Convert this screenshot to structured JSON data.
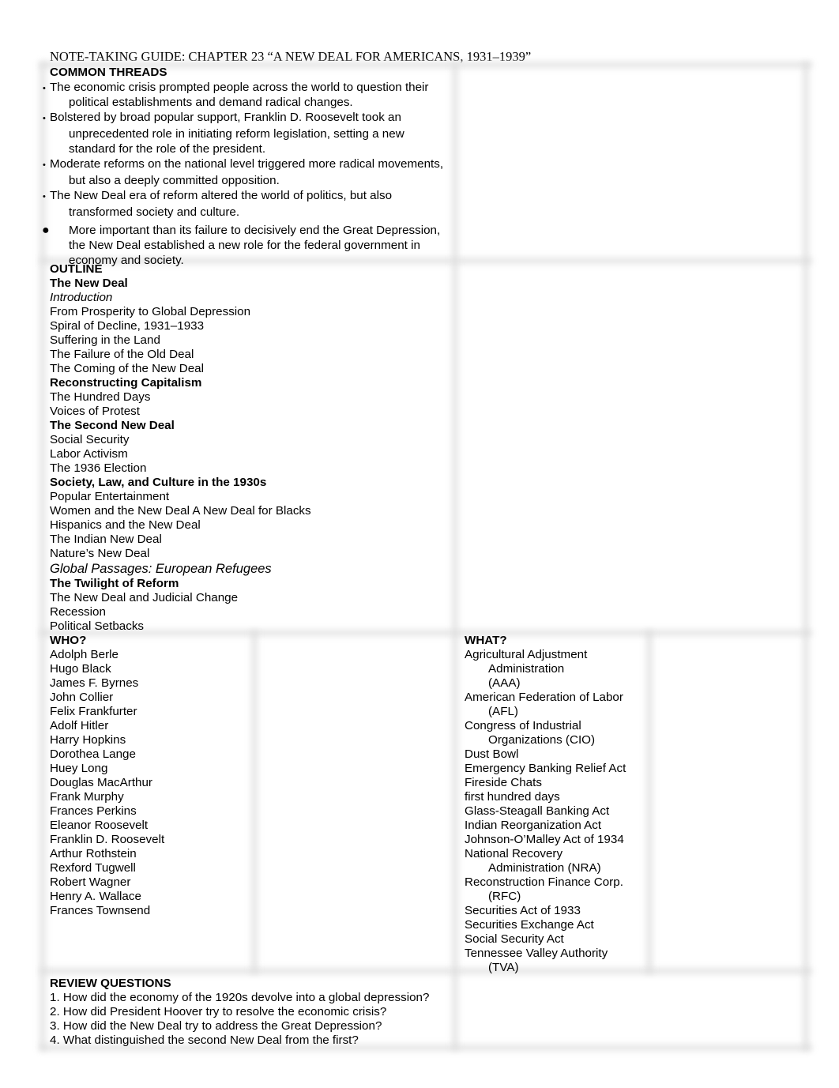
{
  "document": {
    "title": "NOTE-TAKING GUIDE: CHAPTER 23 “A NEW DEAL FOR AMERICANS, 1931–1939”"
  },
  "common_threads": {
    "heading": "COMMON THREADS",
    "items": [
      {
        "bullet": "•",
        "text": "The economic crisis prompted people across the world to question their political establishments and demand radical changes."
      },
      {
        "bullet": "•",
        "text": "Bolstered by broad popular support, Franklin D. Roosevelt took an unprecedented role in initiating reform legislation, setting a new standard for the role of the president."
      },
      {
        "bullet": "•",
        "text": "Moderate reforms on the national level triggered more radical movements, but also a deeply committed opposition."
      },
      {
        "bullet": "•",
        "text": "The New Deal era of reform altered the world of politics, but also transformed society and culture."
      },
      {
        "bullet": "●",
        "text": "More important than its failure to decisively end the Great Depression, the New Deal established a new role for the federal government in economy and society."
      }
    ]
  },
  "outline": {
    "heading": "OUTLINE",
    "lines": [
      {
        "text": "The New Deal",
        "style": "bold"
      },
      {
        "text": "Introduction",
        "style": "italic"
      },
      {
        "text": "From Prosperity to Global Depression",
        "style": "normal"
      },
      {
        "text": "Spiral of Decline, 1931–1933",
        "style": "normal"
      },
      {
        "text": "Suffering in the Land",
        "style": "normal"
      },
      {
        "text": "The Failure of the Old Deal",
        "style": "normal"
      },
      {
        "text": "The Coming of the New Deal",
        "style": "normal"
      },
      {
        "text": "Reconstructing Capitalism",
        "style": "bold"
      },
      {
        "text": "The Hundred Days",
        "style": "normal"
      },
      {
        "text": "Voices of Protest",
        "style": "normal"
      },
      {
        "text": "The Second New Deal",
        "style": "bold"
      },
      {
        "text": "Social Security",
        "style": "normal"
      },
      {
        "text": "Labor Activism",
        "style": "normal"
      },
      {
        "text": "The 1936 Election",
        "style": "normal"
      },
      {
        "text": "Society, Law, and Culture in the 1930s",
        "style": "bold"
      },
      {
        "text": "Popular Entertainment",
        "style": "normal"
      },
      {
        "text": "Women and the New Deal A New Deal for Blacks",
        "style": "normal"
      },
      {
        "text": "Hispanics and the New Deal",
        "style": "normal"
      },
      {
        "text": "The Indian New Deal",
        "style": "normal"
      },
      {
        "text": "Nature’s New Deal",
        "style": "normal"
      },
      {
        "text": "Global Passages: European Refugees",
        "style": "italic-large"
      },
      {
        "text": "The Twilight of Reform",
        "style": "bold"
      },
      {
        "text": "The New Deal and Judicial Change",
        "style": "normal"
      },
      {
        "text": "Recession",
        "style": "normal"
      },
      {
        "text": "Political Setbacks",
        "style": "normal"
      }
    ]
  },
  "who": {
    "heading": "WHO?",
    "names": [
      "Adolph Berle",
      "Hugo Black",
      "James F. Byrnes",
      "John Collier",
      "Felix Frankfurter",
      "Adolf Hitler",
      "Harry Hopkins",
      "Dorothea Lange",
      "Huey Long",
      "Douglas MacArthur",
      "Frank Murphy",
      "Frances Perkins",
      "Eleanor Roosevelt",
      "Franklin D. Roosevelt",
      "Arthur Rothstein",
      "Rexford Tugwell",
      "Robert Wagner",
      "Henry A. Wallace",
      "Frances Townsend"
    ]
  },
  "what": {
    "heading": "WHAT?",
    "terms": [
      {
        "first": "Agricultural Adjustment",
        "rest": [
          "Administration",
          "(AAA)"
        ]
      },
      {
        "first": "American Federation of Labor",
        "rest": [
          "(AFL)"
        ]
      },
      {
        "first": "Congress of Industrial",
        "rest": [
          "Organizations (CIO)"
        ]
      },
      {
        "first": "Dust Bowl",
        "rest": []
      },
      {
        "first": "Emergency Banking Relief Act",
        "rest": []
      },
      {
        "first": "Fireside Chats",
        "rest": []
      },
      {
        "first": "first hundred days",
        "rest": []
      },
      {
        "first": "Glass-Steagall Banking Act",
        "rest": []
      },
      {
        "first": "Indian Reorganization Act",
        "rest": []
      },
      {
        "first": "Johnson-O’Malley Act of 1934",
        "rest": []
      },
      {
        "first": "National Recovery",
        "rest": [
          "Administration (NRA)"
        ]
      },
      {
        "first": "Reconstruction Finance Corp.",
        "rest": [
          "(RFC)"
        ]
      },
      {
        "first": "Securities Act of 1933",
        "rest": []
      },
      {
        "first": "Securities Exchange Act",
        "rest": []
      },
      {
        "first": "Social Security Act",
        "rest": []
      },
      {
        "first": "Tennessee Valley Authority",
        "rest": [
          "(TVA)"
        ]
      }
    ]
  },
  "review_questions": {
    "heading": "REVIEW QUESTIONS",
    "questions": [
      "1. How did the economy of the 1920s devolve into a global depression?",
      "2. How did President Hoover try to resolve the economic crisis?",
      "3. How did the New Deal try to address the Great Depression?",
      "4. What distinguished the second New Deal from the first?"
    ]
  },
  "notes_areas": {
    "common_threads_notes": "",
    "outline_notes": "",
    "who_notes": "",
    "what_notes": "",
    "review_notes": ""
  }
}
